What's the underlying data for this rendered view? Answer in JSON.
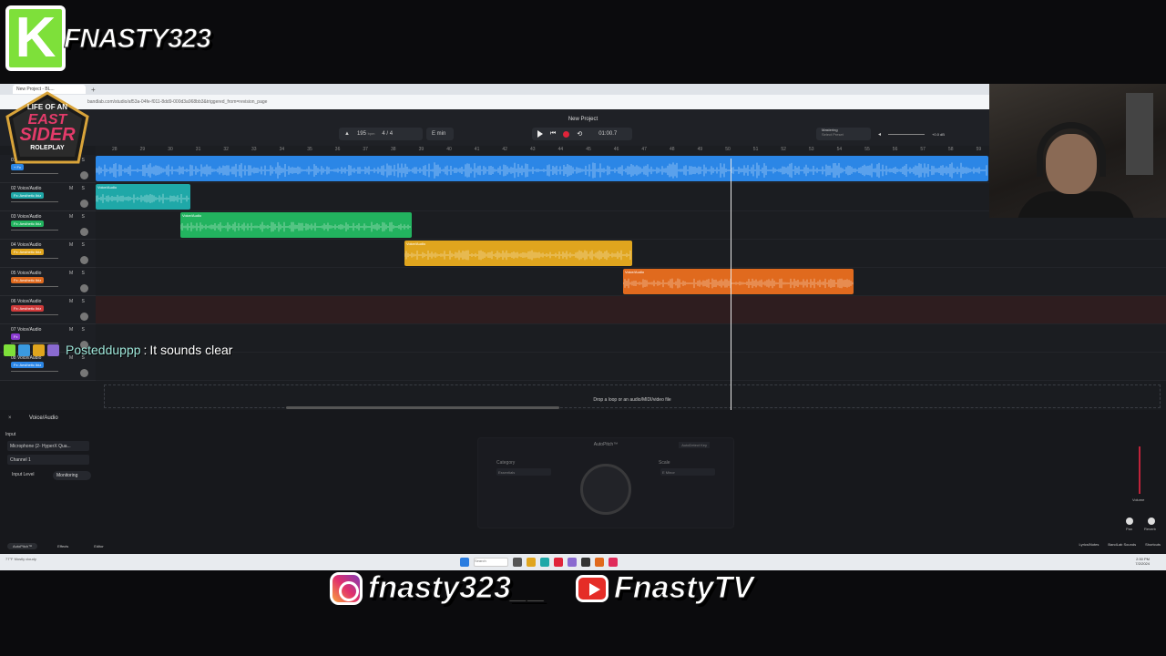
{
  "overlay": {
    "k_letter": "K",
    "brand_name": "FNASTY323",
    "logo_lines": [
      "LIFE OF AN",
      "EAST",
      "SIDER",
      "ROLEPLAY"
    ],
    "instagram_handle": "fnasty323__",
    "youtube_channel": "FnastyTV",
    "colors": {
      "k_green": "#7ee03a",
      "instagram": "#e1306c",
      "youtube": "#e52d27"
    }
  },
  "browser": {
    "tab_title": "New Project - BL...",
    "new_tab": "+",
    "url": "bandlab.com/studio/af53a-04fe-f011-8dd9-000d3a968bb3&triggered_from=revision_page"
  },
  "daw": {
    "project_name": "New Project",
    "tempo": "195",
    "tempo_unit": "bpm",
    "time_signature": "4 / 4",
    "key": "E min",
    "time_display": "01:00.7",
    "mastering_label": "Mastering",
    "mastering_preset": "Select Preset",
    "master_gain": "+0.0 dB",
    "ruler_bars": [
      "28",
      "29",
      "30",
      "31",
      "32",
      "33",
      "34",
      "35",
      "36",
      "37",
      "38",
      "39",
      "40",
      "41",
      "42",
      "43",
      "44",
      "45",
      "46",
      "47",
      "48",
      "49",
      "50",
      "51",
      "52",
      "53",
      "54",
      "55",
      "56",
      "57",
      "58",
      "59"
    ],
    "tracks": [
      {
        "name": "01 Voice/Audio",
        "fx": "+ Fx",
        "ms": "M S",
        "color": "#2b86e6",
        "fx_color": "#2b86e6"
      },
      {
        "name": "02 Voice/Audio",
        "fx": "Fx: Aesthetic Ibiz",
        "ms": "M S",
        "color": "#1fa8a8",
        "fx_color": "#1fa8a8"
      },
      {
        "name": "03 Voice/Audio",
        "fx": "Fx: Aesthetic Ibiz",
        "ms": "M S",
        "color": "#22b35f",
        "fx_color": "#22b35f"
      },
      {
        "name": "04 Voice/Audio",
        "fx": "Fx: Aesthetic Ibiz",
        "ms": "M S",
        "color": "#e0a51e",
        "fx_color": "#e0a51e"
      },
      {
        "name": "05 Voice/Audio",
        "fx": "Fx: Aesthetic Ibiz",
        "ms": "M S",
        "color": "#e06a1e",
        "fx_color": "#e06a1e"
      },
      {
        "name": "06 Voice/Audio",
        "fx": "Fx: Aesthetic Ibiz",
        "ms": "M S",
        "color": "#d03a3a",
        "fx_color": "#d03a3a"
      },
      {
        "name": "07 Voice/Audio",
        "fx": "Fx",
        "ms": "M S",
        "color": "#8a3ad0",
        "fx_color": "#8a3ad0"
      },
      {
        "name": "08 Voice/Audio",
        "fx": "Fx: Aesthetic Ibiz",
        "ms": "M S",
        "color": "#2b86e6",
        "fx_color": "#2b86e6"
      }
    ],
    "clip_label": "Voice/Audio",
    "drop_text": "Drop a loop or an audio/MIDI/video file"
  },
  "chat": {
    "user": "Postedduppp",
    "separator": ":",
    "message": "It sounds clear"
  },
  "panel": {
    "close": "×",
    "title": "Voice/Audio",
    "input_label": "Input",
    "input_device": "Microphone (2- HyperX Qua...",
    "channel": "Channel 1",
    "input_level": "Input Level",
    "monitoring": "Monitoring",
    "autopitch_title": "AutoPitch™",
    "autodetect": "AutoDetect Key",
    "category_label": "Category",
    "category_value": "Essentials",
    "scale_label": "Scale",
    "scale_value": "E Minor",
    "volume_label": "Volume",
    "pan_label": "Pan",
    "reverb_label": "Reverb",
    "footer_autopitch": "AutoPitch™",
    "footer_effects": "Effects",
    "footer_editor": "Editor",
    "footer_lyrics": "Lyrics/Notes",
    "footer_sounds": "BandLab Sounds",
    "footer_shortcuts": "Shortcuts"
  },
  "taskbar": {
    "weather": "77°F Mostly cloudy",
    "search_placeholder": "Search",
    "time": "2:30 PM",
    "date": "7/2/2024"
  }
}
